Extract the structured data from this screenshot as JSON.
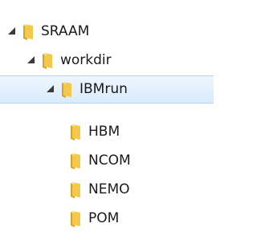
{
  "tree": {
    "items": [
      {
        "label": "SRAAM",
        "expanded": true,
        "selected": false,
        "level": 0,
        "icon": "folder-icon"
      },
      {
        "label": "workdir",
        "expanded": true,
        "selected": false,
        "level": 1,
        "icon": "folder-icon"
      },
      {
        "label": "IBMrun",
        "expanded": true,
        "selected": true,
        "level": 2,
        "icon": "folder-icon"
      },
      {
        "label": "HBM",
        "expanded": false,
        "selected": false,
        "level": 3,
        "icon": "folder-icon"
      },
      {
        "label": "NCOM",
        "expanded": false,
        "selected": false,
        "level": 3,
        "icon": "folder-icon"
      },
      {
        "label": "NEMO",
        "expanded": false,
        "selected": false,
        "level": 3,
        "icon": "folder-icon"
      },
      {
        "label": "POM",
        "expanded": false,
        "selected": false,
        "level": 3,
        "icon": "folder-icon"
      }
    ]
  },
  "colors": {
    "folder_body": "#f2c94c",
    "folder_dark": "#d9a520",
    "selection_border": "#b3d4f2",
    "selection_fill": "#dcecfc"
  }
}
